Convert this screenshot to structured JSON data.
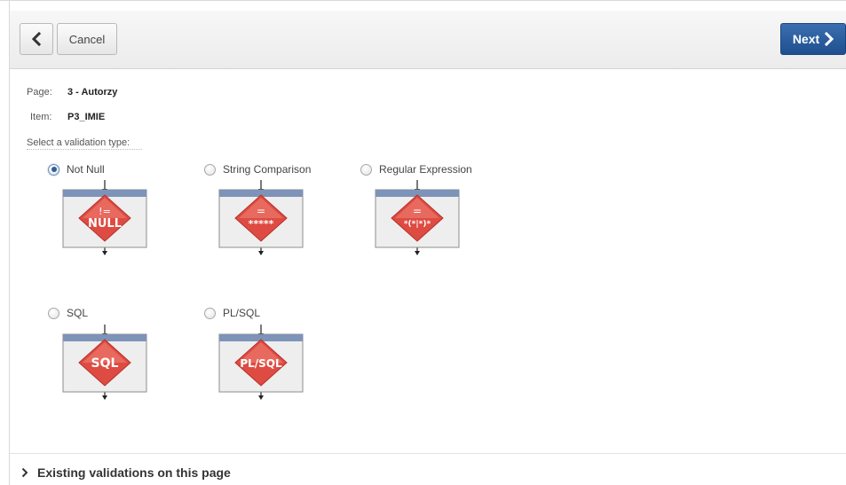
{
  "toolbar": {
    "back_icon": "chevron-left-icon",
    "cancel_label": "Cancel",
    "next_label": "Next",
    "next_icon": "chevron-right-icon",
    "accent": "#2a5c9e"
  },
  "meta": {
    "page_label": "Page:",
    "page_value": "3 - Autorzy",
    "item_label": "Item:",
    "item_value": "P3_IMIE"
  },
  "select_label": "Select a validation type:",
  "options": [
    {
      "label": "Not Null",
      "checked": true,
      "glyph_top": "!=",
      "glyph_bottom": "NULL",
      "icon": "not-null-diagram-icon"
    },
    {
      "label": "String Comparison",
      "checked": false,
      "glyph_top": "=",
      "glyph_bottom": "*****",
      "icon": "string-comparison-diagram-icon"
    },
    {
      "label": "Regular Expression",
      "checked": false,
      "glyph_top": "=",
      "glyph_bottom": "*(*|*)*",
      "icon": "regular-expression-diagram-icon"
    },
    {
      "label": "SQL",
      "checked": false,
      "glyph_top": "",
      "glyph_bottom": "SQL",
      "icon": "sql-diagram-icon"
    },
    {
      "label": "PL/SQL",
      "checked": false,
      "glyph_top": "",
      "glyph_bottom": "PL/SQL",
      "icon": "plsql-diagram-icon"
    }
  ],
  "footer": {
    "existing_label": "Existing validations on this page",
    "expand_icon": "chevron-right-icon"
  }
}
